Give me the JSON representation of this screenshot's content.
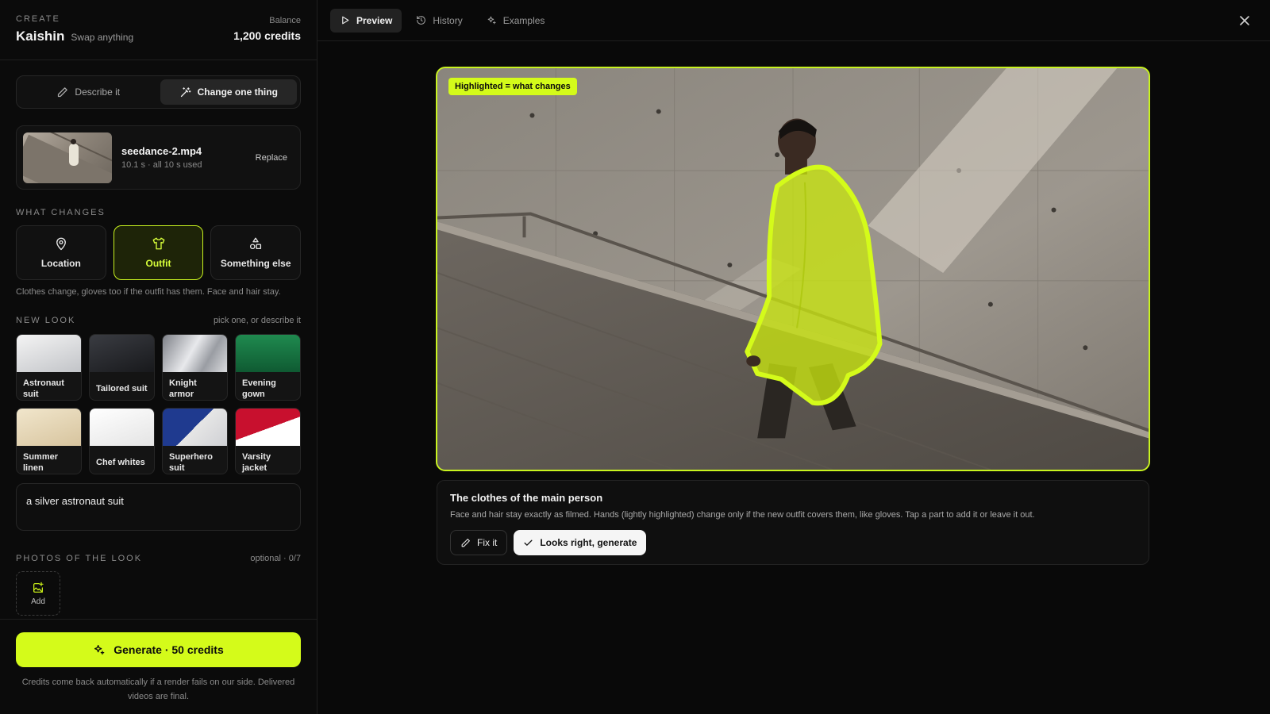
{
  "header": {
    "eyebrow": "CREATE",
    "app_name": "Kaishin",
    "app_sub": "Swap anything",
    "balance_label": "Balance",
    "balance_value": "1,200 credits"
  },
  "mode": {
    "describe_label": "Describe it",
    "change_label": "Change one thing",
    "active": "change"
  },
  "file": {
    "name": "seedance-2.mp4",
    "meta": "10.1 s · all 10 s used",
    "replace_label": "Replace"
  },
  "what_changes": {
    "label": "WHAT CHANGES",
    "options": [
      {
        "label": "Location",
        "icon": "location-pin-icon",
        "active": false
      },
      {
        "label": "Outfit",
        "icon": "shirt-icon",
        "active": true
      },
      {
        "label": "Something else",
        "icon": "shapes-icon",
        "active": false
      }
    ],
    "helper": "Clothes change, gloves too if the outfit has them. Face and hair stay."
  },
  "new_look": {
    "label": "NEW LOOK",
    "hint": "pick one, or describe it",
    "items": [
      {
        "label": "Astronaut suit",
        "swatch_colors": [
          "#f2f2f2",
          "#c4c6c9"
        ]
      },
      {
        "label": "Tailored suit",
        "swatch_colors": [
          "#34363b",
          "#1b1c20"
        ]
      },
      {
        "label": "Knight armor",
        "swatch_colors": [
          "#8d9096",
          "#e6e7ea"
        ]
      },
      {
        "label": "Evening gown",
        "swatch_colors": [
          "#1f8a4f",
          "#0f5a32"
        ]
      },
      {
        "label": "Summer linen",
        "swatch_colors": [
          "#efe3c8",
          "#d9c7a2"
        ]
      },
      {
        "label": "Chef whites",
        "swatch_colors": [
          "#ffffff",
          "#e5e5e5"
        ]
      },
      {
        "label": "Superhero suit",
        "swatch_colors": [
          "#1f3a8f",
          "#e6e6e6"
        ]
      },
      {
        "label": "Varsity jacket",
        "swatch_colors": [
          "#c8102e",
          "#ffffff"
        ]
      }
    ]
  },
  "prompt": {
    "value": "a silver astronaut suit"
  },
  "photos": {
    "label": "PHOTOS OF THE LOOK",
    "hint": "optional · 0/7",
    "add_label": "Add"
  },
  "footer": {
    "generate_label": "Generate · 50 credits",
    "note": "Credits come back automatically if a render fails on our side. Delivered videos are final."
  },
  "tabs": [
    {
      "label": "Preview",
      "icon": "play-icon",
      "active": true
    },
    {
      "label": "History",
      "icon": "history-icon",
      "active": false
    },
    {
      "label": "Examples",
      "icon": "sparkles-icon",
      "active": false
    }
  ],
  "preview": {
    "badge": "Highlighted = what changes"
  },
  "info": {
    "title": "The clothes of the main person",
    "desc": "Face and hair stay exactly as filmed. Hands (lightly highlighted) change only if the new outfit covers them, like gloves. Tap a part to add it or leave it out.",
    "fix_label": "Fix it",
    "ok_label": "Looks right, generate"
  },
  "colors": {
    "accent": "#d4fb1a",
    "highlight": "#c8f31f",
    "background": "#0a0a0a"
  }
}
